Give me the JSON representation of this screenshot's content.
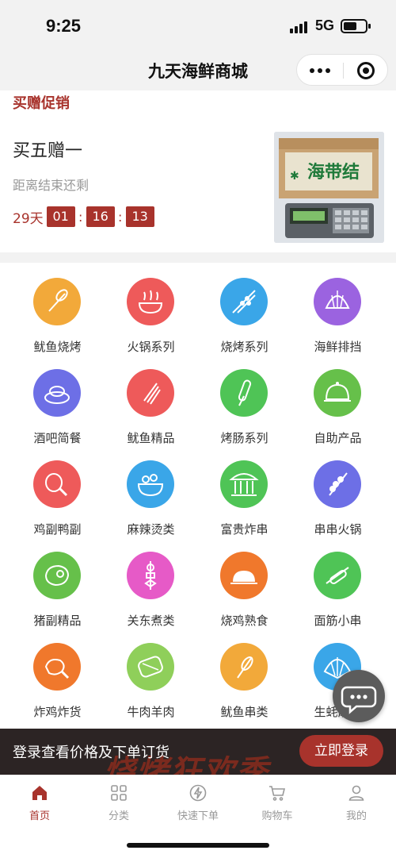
{
  "status": {
    "time": "9:25",
    "network": "5G"
  },
  "header": {
    "title": "九天海鲜商城"
  },
  "promo": {
    "heading": "买赠促销",
    "name": "买五赠一",
    "subtitle": "距离结束还剩",
    "days": "29天",
    "hours": "01",
    "minutes": "16",
    "seconds": "13",
    "image_text": "海带结"
  },
  "categories": [
    {
      "label": "鱿鱼烧烤",
      "icon": "squid-skewer-icon",
      "color": "#f2a93a"
    },
    {
      "label": "火锅系列",
      "icon": "hotpot-icon",
      "color": "#ee5a5a"
    },
    {
      "label": "烧烤系列",
      "icon": "skewers-icon",
      "color": "#3aa6e8"
    },
    {
      "label": "海鲜排挡",
      "icon": "shell-icon",
      "color": "#9b63e0"
    },
    {
      "label": "酒吧简餐",
      "icon": "snack-plate-icon",
      "color": "#6d6fe6"
    },
    {
      "label": "鱿鱼精品",
      "icon": "squid-icon",
      "color": "#ee5a5a"
    },
    {
      "label": "烤肠系列",
      "icon": "sausage-icon",
      "color": "#4fc456"
    },
    {
      "label": "自助产品",
      "icon": "cloche-icon",
      "color": "#66c04a"
    },
    {
      "label": "鸡副鸭副",
      "icon": "drumstick-icon",
      "color": "#ee5a5a"
    },
    {
      "label": "麻辣烫类",
      "icon": "bowl-icon",
      "color": "#3aa6e8"
    },
    {
      "label": "富贵炸串",
      "icon": "temple-icon",
      "color": "#4fc456"
    },
    {
      "label": "串串火锅",
      "icon": "bead-skewer-icon",
      "color": "#6d6fe6"
    },
    {
      "label": "猪副精品",
      "icon": "meat-icon",
      "color": "#66c04a"
    },
    {
      "label": "关东煮类",
      "icon": "oden-icon",
      "color": "#e65ac7"
    },
    {
      "label": "烧鸡熟食",
      "icon": "roast-chicken-icon",
      "color": "#f0782c"
    },
    {
      "label": "面筋小串",
      "icon": "gluten-skewer-icon",
      "color": "#4fc456"
    },
    {
      "label": "炸鸡炸货",
      "icon": "fried-chicken-icon",
      "color": "#f0782c"
    },
    {
      "label": "牛肉羊肉",
      "icon": "meat-roll-icon",
      "color": "#8fcf5a"
    },
    {
      "label": "鱿鱼串类",
      "icon": "squid-kebab-icon",
      "color": "#f2a93a"
    },
    {
      "label": "生蚝扇贝",
      "icon": "scallop-icon",
      "color": "#3aa6e8"
    }
  ],
  "banner": {
    "text": "登录查看价格及下单订货",
    "button": "立即登录",
    "background_text": "烧烤狂欢季"
  },
  "tabs": [
    {
      "label": "首页",
      "icon": "home-icon",
      "active": true
    },
    {
      "label": "分类",
      "icon": "category-grid-icon",
      "active": false
    },
    {
      "label": "快速下单",
      "icon": "lightning-icon",
      "active": false
    },
    {
      "label": "购物车",
      "icon": "cart-icon",
      "active": false
    },
    {
      "label": "我的",
      "icon": "user-icon",
      "active": false
    }
  ],
  "colors": {
    "accent": "#a8332c",
    "tab_inactive": "#999999"
  }
}
